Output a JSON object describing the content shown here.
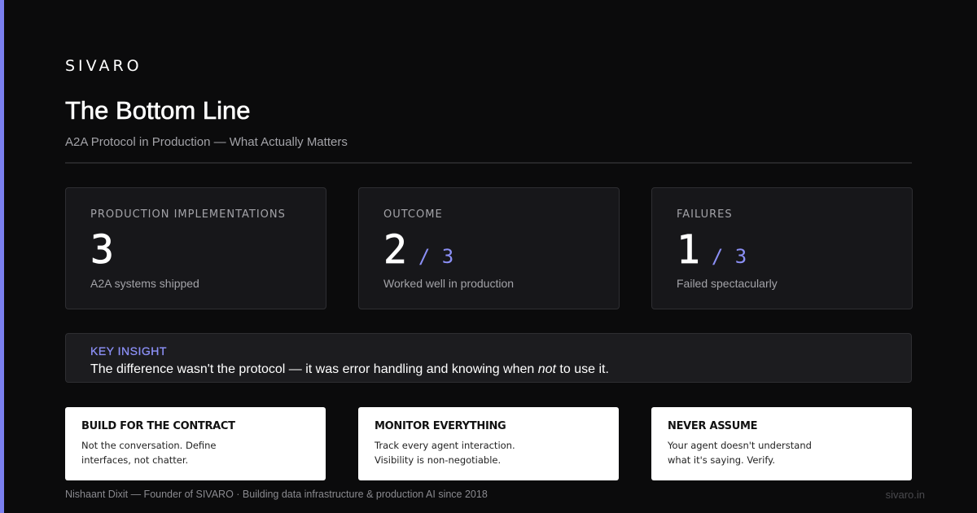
{
  "brand": "SIVARO",
  "title": "The Bottom Line",
  "subtitle": "A2A Protocol in Production — What Actually Matters",
  "stats": [
    {
      "label": "PRODUCTION IMPLEMENTATIONS",
      "value": "3",
      "of": "",
      "desc": "A2A systems shipped"
    },
    {
      "label": "OUTCOME",
      "value": "2",
      "of": "/ 3",
      "desc": "Worked well in production"
    },
    {
      "label": "FAILURES",
      "value": "1",
      "of": "/ 3",
      "desc": "Failed spectacularly"
    }
  ],
  "insight": {
    "label": "KEY INSIGHT",
    "text_before": "The difference wasn't the protocol — it was error handling and knowing when ",
    "text_emphasis": "not",
    "text_after": " to use it."
  },
  "tips": [
    {
      "title": "BUILD FOR THE CONTRACT",
      "line1": "Not the conversation. Define",
      "line2": "interfaces, not chatter."
    },
    {
      "title": "MONITOR EVERYTHING",
      "line1": "Track every agent interaction.",
      "line2": "Visibility is non-negotiable."
    },
    {
      "title": "NEVER ASSUME",
      "line1": "Your agent doesn't understand",
      "line2": "what it's saying. Verify."
    }
  ],
  "footer": {
    "byline": "Nishaant Dixit — Founder of SIVARO · Building data infrastructure & production AI since 2018",
    "url": "sivaro.in"
  },
  "colors": {
    "background": "#0b0b0c",
    "accent": "#7b80f0",
    "card": "#17171a",
    "tip_card": "#ffffff"
  }
}
